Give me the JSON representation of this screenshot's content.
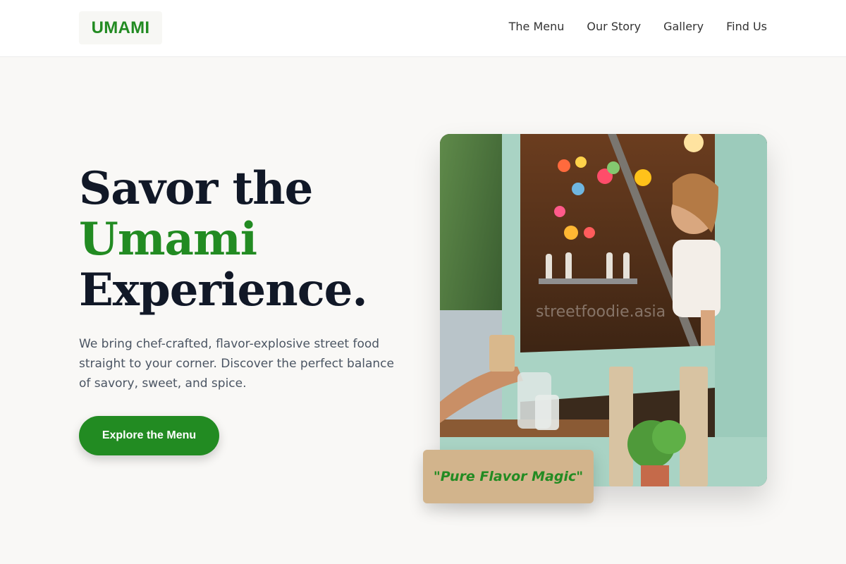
{
  "header": {
    "logo": "UMAMI",
    "nav": [
      "The Menu",
      "Our Story",
      "Gallery",
      "Find Us"
    ]
  },
  "hero": {
    "headline_line1": "Savor the",
    "headline_accent": "Umami",
    "headline_line3": "Experience.",
    "lead": "We bring chef-crafted, flavor-explosive street food straight to your corner. Discover the perfect balance of savory, sweet, and spice.",
    "cta_label": "Explore the Menu"
  },
  "photo": {
    "alt": "Street food truck bartender serving drinks",
    "watermark": "streetfoodie.asia"
  },
  "badge": {
    "text": "\"Pure Flavor Magic\""
  },
  "colors": {
    "brand": "#228b22",
    "heading": "#111827",
    "badge_bg": "#d2b48c",
    "page_bg": "#f9f8f6"
  }
}
